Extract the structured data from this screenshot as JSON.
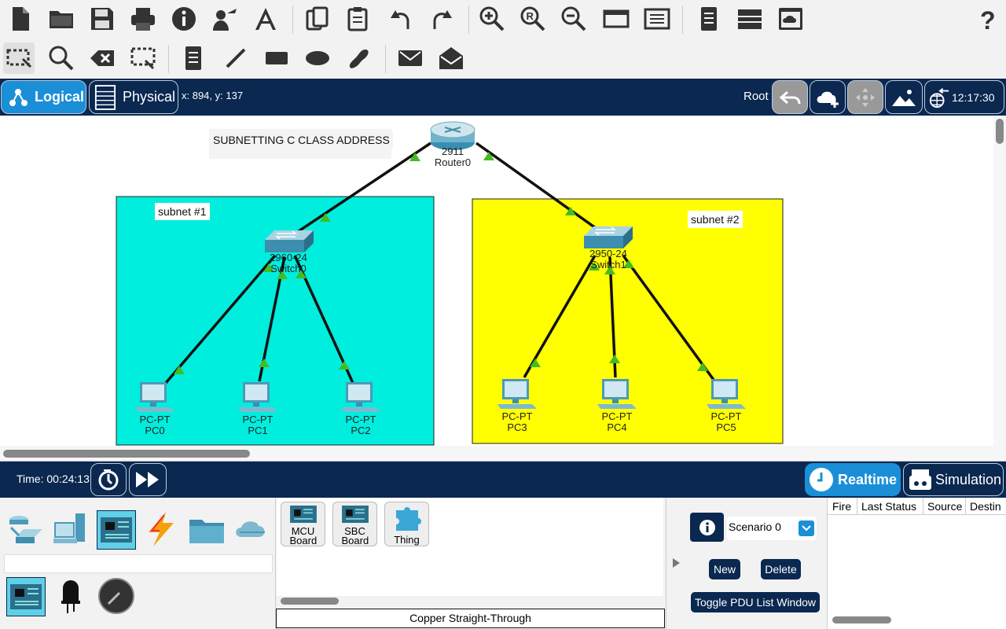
{
  "toolbar_top": {
    "icons": [
      "new-file-icon",
      "open-folder-icon",
      "save-icon",
      "print-icon",
      "info-icon",
      "activity-wizard-icon",
      "network-info-icon",
      "copy-icon",
      "paste-icon",
      "undo-icon",
      "redo-icon",
      "zoom-in-icon",
      "zoom-reset-icon",
      "zoom-out-icon",
      "drawing-palette-icon",
      "custom-device-icon",
      "pdu-list-icon",
      "physical-view-icon",
      "cluster-icon",
      "help-icon"
    ]
  },
  "toolbar_second": {
    "icons": [
      "select-icon",
      "inspect-icon",
      "delete-icon",
      "resize-icon",
      "note-icon",
      "line-icon",
      "rectangle-icon",
      "ellipse-icon",
      "freeform-icon",
      "simple-pdu-icon",
      "complex-pdu-icon"
    ]
  },
  "modebar": {
    "logical": "Logical",
    "physical": "Physical",
    "coords": "x: 894, y: 137",
    "root": "Root",
    "clock": "12:17:30"
  },
  "canvas": {
    "title": "SUBNETTING C CLASS ADDRESS",
    "subnet1": {
      "label": "subnet #1",
      "color": "#00eedd"
    },
    "subnet2": {
      "label": "subnet #2",
      "color": "#ffff00"
    },
    "router": {
      "model": "2911",
      "name": "Router0"
    },
    "switch0": {
      "model": "2960-24",
      "name": "Switch0"
    },
    "switch1": {
      "model": "2950-24",
      "name": "Switch1"
    },
    "pcs": [
      {
        "model": "PC-PT",
        "name": "PC0"
      },
      {
        "model": "PC-PT",
        "name": "PC1"
      },
      {
        "model": "PC-PT",
        "name": "PC2"
      },
      {
        "model": "PC-PT",
        "name": "PC3"
      },
      {
        "model": "PC-PT",
        "name": "PC4"
      },
      {
        "model": "PC-PT",
        "name": "PC5"
      }
    ],
    "link_light_color": "#44bb22"
  },
  "timebar": {
    "time": "Time: 00:24:13",
    "realtime": "Realtime",
    "simulation": "Simulation"
  },
  "bottom": {
    "categories": [
      "network-devices-icon",
      "end-devices-icon",
      "components-icon",
      "connections-icon",
      "miscellaneous-icon",
      "multiuser-icon"
    ],
    "subcategories": [
      "board-icon",
      "led-icon",
      "potentiometer-icon"
    ],
    "devices": [
      "MCU Board",
      "SBC Board",
      "Thing"
    ],
    "cable_label": "Copper Straight-Through",
    "scenario": "Scenario 0",
    "new_btn": "New",
    "delete_btn": "Delete",
    "toggle_pdu": "Toggle PDU List Window",
    "pdu_columns": [
      "Fire",
      "Last Status",
      "Source",
      "Destin"
    ]
  },
  "colors": {
    "navy": "#0a2850",
    "accent": "#1a8fd8"
  }
}
